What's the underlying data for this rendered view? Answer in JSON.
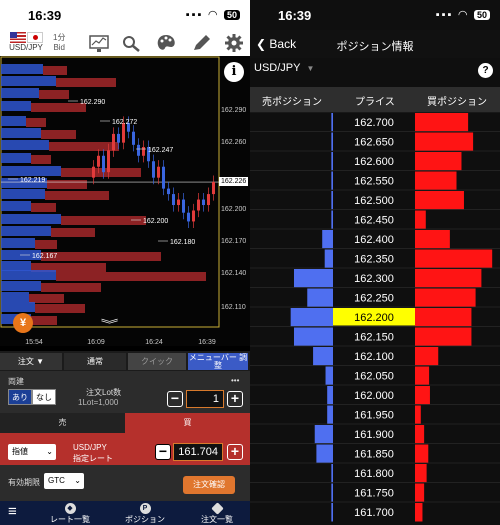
{
  "left_status": {
    "time": "16:39",
    "battery": "50"
  },
  "right_status": {
    "time": "16:39",
    "battery": "50"
  },
  "toolbar": {
    "pair": "USD/JPY",
    "timeframe": "1分",
    "side": "Bid",
    "icons": [
      "chart-icon",
      "compare-icon",
      "palette-icon",
      "pen-icon",
      "gear-icon"
    ]
  },
  "chart": {
    "price_labels": [
      "162.290",
      "162.260",
      "162.226",
      "162.200",
      "162.170",
      "162.140",
      "162.110"
    ],
    "current_price": "162.226",
    "time_labels": [
      "15:54",
      "16:09",
      "16:24",
      "16:39"
    ],
    "annotations": [
      "162.290",
      "162.272",
      "162.247",
      "162.219",
      "162.200",
      "162.180",
      "162.167"
    ],
    "yen_icon": "¥"
  },
  "order_panel": {
    "tabs": [
      "注文 ▼",
      "通常",
      "クイック",
      "メニューバー 調整"
    ],
    "settlement_label": "両建",
    "toggle_yes": "あり",
    "toggle_no": "なし",
    "lot_label": "注文Lot数",
    "lot_sub": "1Lot=1,000",
    "lot_value": "1",
    "more": "•••",
    "sell_label": "売",
    "buy_label": "買",
    "order_type": "指値",
    "price_label_1": "USD/JPY",
    "price_label_2": "指定レート",
    "price_value": "161.704",
    "expiry_label": "有効期限",
    "expiry_value": "GTC",
    "confirm": "注文確認"
  },
  "bottom_nav": {
    "menu_icon": "≡",
    "items": [
      {
        "label": "レート一覧",
        "icon": "rate-icon"
      },
      {
        "label": "ポジション",
        "icon": "P"
      },
      {
        "label": "注文一覧",
        "icon": "order-icon"
      }
    ]
  },
  "right": {
    "back": "Back",
    "title": "ポジション情報",
    "pair": "USD/JPY",
    "help": "?",
    "col_sell": "売ポジション",
    "col_price": "プライス",
    "col_buy": "買ポジション",
    "highlight_price": "162.200",
    "rows": [
      {
        "price": "162.700",
        "sell": 0.02,
        "buy": 0.64
      },
      {
        "price": "162.650",
        "sell": 0.02,
        "buy": 0.7
      },
      {
        "price": "162.600",
        "sell": 0.02,
        "buy": 0.56
      },
      {
        "price": "162.550",
        "sell": 0.02,
        "buy": 0.5
      },
      {
        "price": "162.500",
        "sell": 0.02,
        "buy": 0.59
      },
      {
        "price": "162.450",
        "sell": 0.02,
        "buy": 0.13
      },
      {
        "price": "162.400",
        "sell": 0.13,
        "buy": 0.42
      },
      {
        "price": "162.350",
        "sell": 0.1,
        "buy": 0.93
      },
      {
        "price": "162.300",
        "sell": 0.47,
        "buy": 0.8
      },
      {
        "price": "162.250",
        "sell": 0.31,
        "buy": 0.73
      },
      {
        "price": "162.200",
        "sell": 0.51,
        "buy": 0.68
      },
      {
        "price": "162.150",
        "sell": 0.47,
        "buy": 0.68
      },
      {
        "price": "162.100",
        "sell": 0.24,
        "buy": 0.28
      },
      {
        "price": "162.050",
        "sell": 0.09,
        "buy": 0.17
      },
      {
        "price": "162.000",
        "sell": 0.07,
        "buy": 0.18
      },
      {
        "price": "161.950",
        "sell": 0.07,
        "buy": 0.07
      },
      {
        "price": "161.900",
        "sell": 0.22,
        "buy": 0.11
      },
      {
        "price": "161.850",
        "sell": 0.2,
        "buy": 0.16
      },
      {
        "price": "161.800",
        "sell": 0.02,
        "buy": 0.14
      },
      {
        "price": "161.750",
        "sell": 0.02,
        "buy": 0.11
      },
      {
        "price": "161.700",
        "sell": 0.02,
        "buy": 0.09
      }
    ]
  }
}
